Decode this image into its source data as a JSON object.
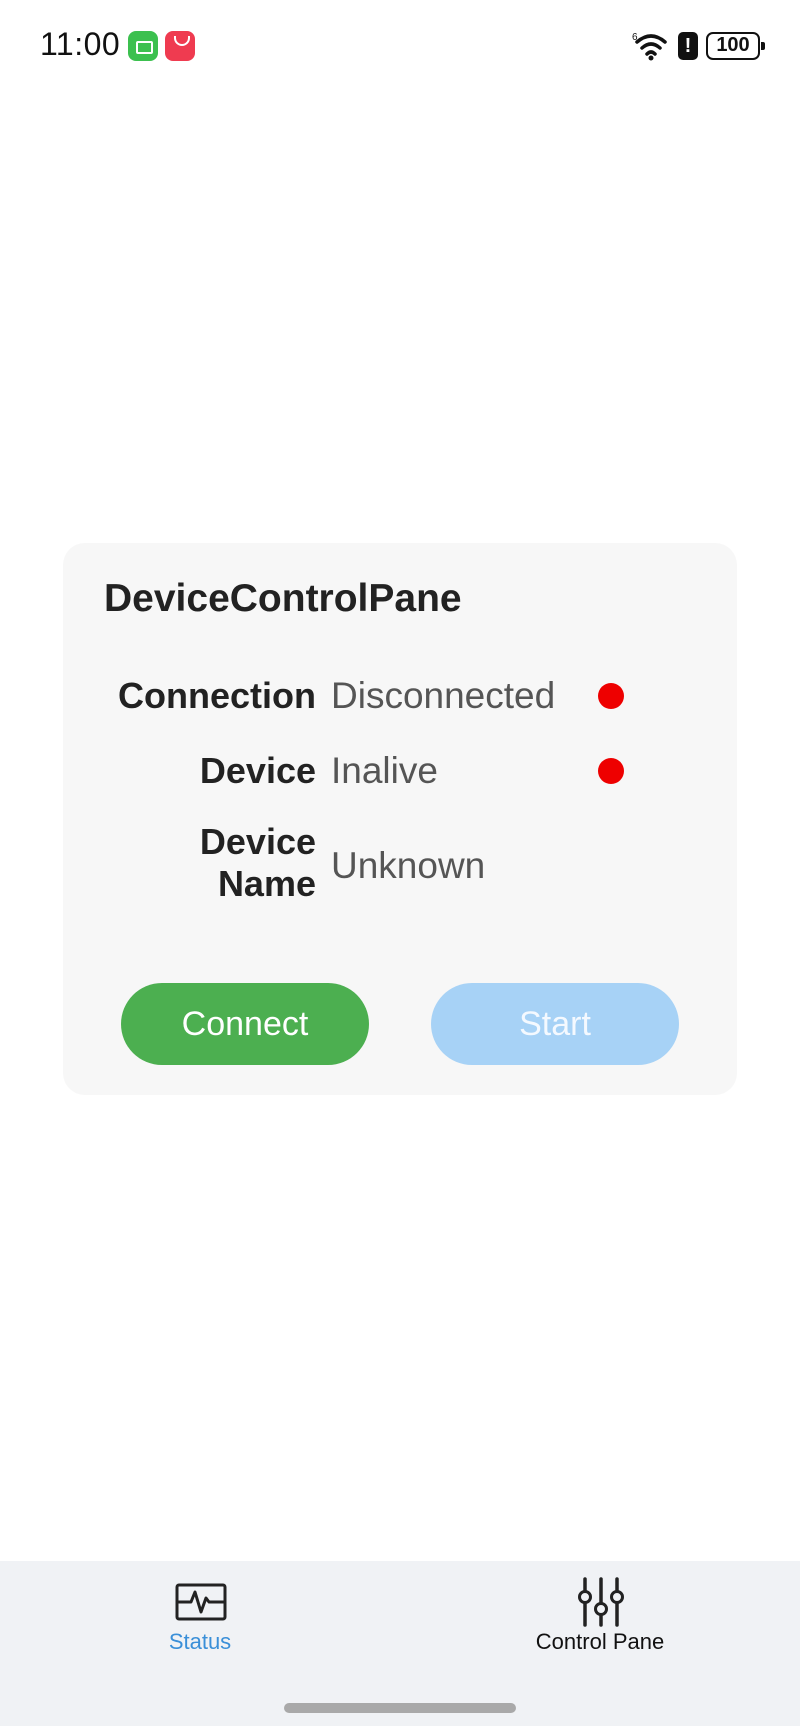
{
  "status_bar": {
    "time": "11:00",
    "battery_level": "100",
    "notification_icons": [
      "battery-saver-icon",
      "app-gallery-icon"
    ],
    "system_icons": [
      "wifi-icon",
      "alert-icon",
      "battery-icon"
    ]
  },
  "card": {
    "title": "DeviceControlPane",
    "rows": [
      {
        "label": "Connection",
        "value": "Disconnected",
        "indicator_color": "#ee0000"
      },
      {
        "label": "Device",
        "value": "Inalive",
        "indicator_color": "#ee0000"
      },
      {
        "label": "Device\nName",
        "value": "Unknown"
      }
    ],
    "buttons": {
      "connect": {
        "label": "Connect",
        "color": "#4caf50"
      },
      "start": {
        "label": "Start",
        "color": "#a7d2f6",
        "enabled": false
      }
    }
  },
  "bottom_nav": {
    "items": [
      {
        "label": "Status",
        "icon": "pulse-monitor-icon",
        "active": true,
        "color": "#3a8fd8"
      },
      {
        "label": "Control Pane",
        "icon": "sliders-icon",
        "active": false,
        "color": "#111111"
      }
    ]
  }
}
